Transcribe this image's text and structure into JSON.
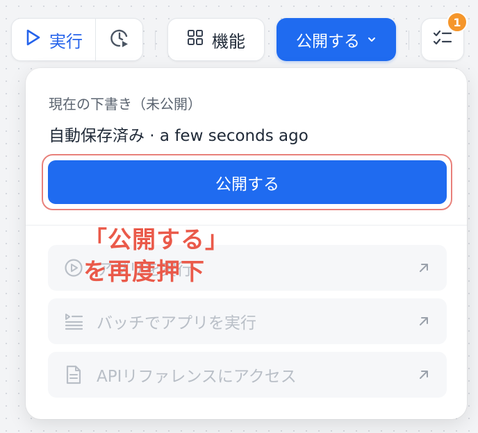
{
  "toolbar": {
    "run_label": "実行",
    "features_label": "機能",
    "publish_label": "公開する",
    "notification_count": "1"
  },
  "panel": {
    "draft_label": "現在の下書き（未公開）",
    "autosave_text": "自動保存済み · a few seconds ago",
    "publish_button_label": "公開する",
    "menu_items": [
      {
        "label": "アプリを実行",
        "icon": "play-circle-icon"
      },
      {
        "label": "バッチでアプリを実行",
        "icon": "batch-list-icon"
      },
      {
        "label": "APIリファレンスにアクセス",
        "icon": "document-icon"
      }
    ]
  },
  "annotation": {
    "line1": "「公開する」",
    "line2": "を再度押下"
  },
  "colors": {
    "primary": "#1f6bf0",
    "annotation": "#ea5a4a",
    "badge": "#f5962b",
    "highlight_border": "#e8807a"
  }
}
